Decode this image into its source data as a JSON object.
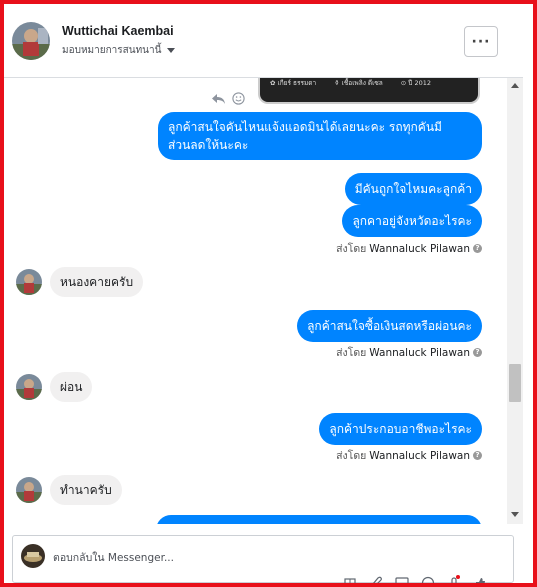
{
  "colors": {
    "accent": "#0084ff",
    "frame": "#e8101a",
    "incoming_bubble": "#f1f0f0"
  },
  "header": {
    "name": "Wuttichai Kaembai",
    "status": "มอบหมายการสนทนานี้",
    "menu_label": "···"
  },
  "preview": {
    "caption_items": [
      "✿ เกียร์ ธรรมดา",
      "⚱ เชื้อเพลิง ดีเซล",
      "⊙ ปี 2012"
    ],
    "reply_icon": "reply-icon",
    "react_icon": "smiley-icon"
  },
  "messages": [
    {
      "side": "out",
      "text": "ลูกค้าสนใจคันไหนแจ้งแอดมินได้เลยนะคะ  รถทุกคันมี",
      "text2": "ส่วนลดให้นะคะ"
    },
    {
      "side": "out",
      "text": "มีคันถูกใจไหมคะลูกค้า"
    },
    {
      "side": "out",
      "text": "ลูกคาอยู่จังหวัดอะไรคะ"
    },
    {
      "side": "in",
      "text": "หนองคายครับ"
    },
    {
      "side": "out",
      "text": "ลูกค้าสนใจซื้อเงินสดหรือผ่อนคะ"
    },
    {
      "side": "in",
      "text": "ผ่อน"
    },
    {
      "side": "out",
      "text": "ลูกค้าประกอบอาชีพอะไรคะ"
    },
    {
      "side": "in",
      "text": "ทำนาครับ"
    }
  ],
  "sent_by": {
    "prefix": "ส่งโดย",
    "agent": "Wannaluck Pilawan",
    "help": "?"
  },
  "composer": {
    "placeholder": "ตอบกลับใน Messenger...",
    "tools": [
      "gift-icon",
      "attach-icon",
      "gif-icon",
      "emoji-icon",
      "mic-icon",
      "like-icon"
    ]
  }
}
